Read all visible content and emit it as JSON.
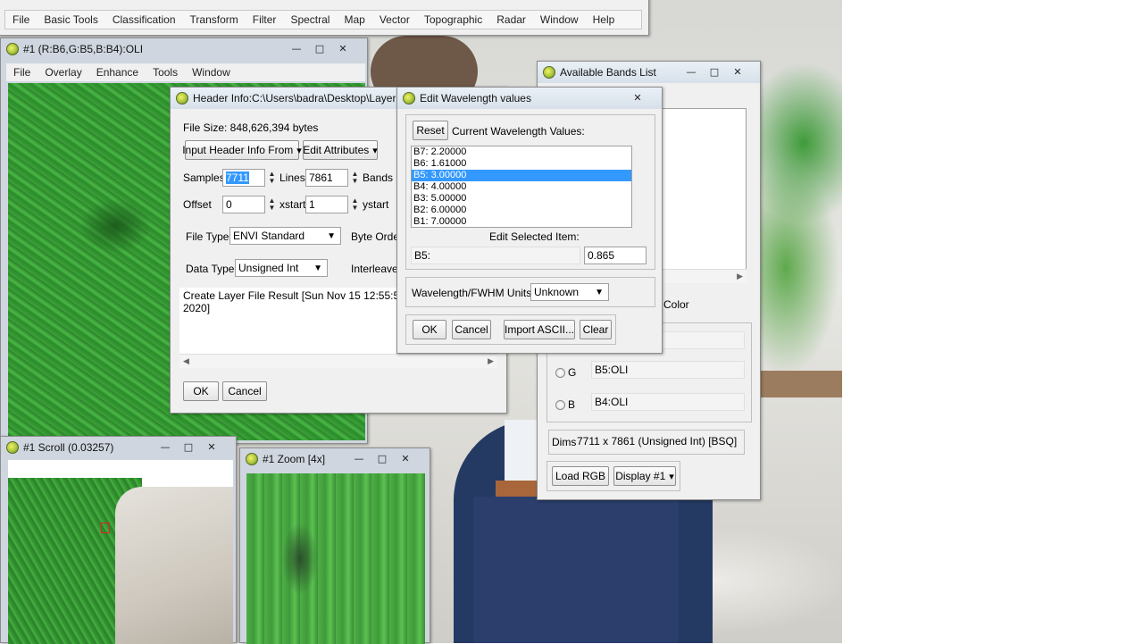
{
  "top_menu": [
    "File",
    "Basic Tools",
    "Classification",
    "Transform",
    "Filter",
    "Spectral",
    "Map",
    "Vector",
    "Topographic",
    "Radar",
    "Window",
    "Help"
  ],
  "image_window": {
    "title": "#1 (R:B6,G:B5,B:B4):OLI",
    "menu": [
      "File",
      "Overlay",
      "Enhance",
      "Tools",
      "Window"
    ]
  },
  "scroll_window": {
    "title": "#1 Scroll (0.03257)"
  },
  "zoom_window": {
    "title": "#1 Zoom [4x]"
  },
  "header_info": {
    "title": "Header Info:C:\\Users\\badra\\Desktop\\Layer",
    "file_size": "File Size: 848,626,394 bytes",
    "input_header_btn": "Input Header Info From",
    "edit_attributes_btn": "Edit Attributes",
    "samples_label": "Samples",
    "samples_value": "7711",
    "lines_label": "Lines",
    "lines_value": "7861",
    "bands_label": "Bands",
    "offset_label": "Offset",
    "offset_value": "0",
    "xstart_label": "xstart",
    "xstart_value": "1",
    "ystart_label": "ystart",
    "file_type_label": "File Type",
    "file_type_value": "ENVI Standard",
    "byte_order_label": "Byte Order",
    "data_type_label": "Data Type",
    "data_type_value": "Unsigned Int",
    "interleave_label": "Interleave",
    "log_line1": "Create Layer File Result [Sun Nov 15 12:55:54",
    "log_line2": "2020]",
    "ok": "OK",
    "cancel": "Cancel"
  },
  "wavelength": {
    "title": "Edit Wavelength values",
    "reset": "Reset",
    "current_label": "Current Wavelength Values:",
    "items": [
      "B7: 2.20000",
      "B6: 1.61000",
      "B5: 3.00000",
      "B4: 4.00000",
      "B3: 5.00000",
      "B2: 6.00000",
      "B1: 7.00000"
    ],
    "selected_index": 2,
    "edit_label": "Edit Selected Item:",
    "edit_band": "B5:",
    "edit_value": "0.865",
    "units_label": "Wavelength/FWHM Units:",
    "units_value": "Unknown",
    "ok": "OK",
    "cancel": "Cancel",
    "import": "Import ASCII...",
    "clear": "Clear"
  },
  "bands": {
    "title": "Available Bands List",
    "color_label": "Color",
    "g_label": "G",
    "g_value": "B5:OLI",
    "b_label": "B",
    "b_value": "B4:OLI",
    "dims_label": "Dims",
    "dims_value": "7711 x 7861 (Unsigned Int) [BSQ]",
    "load_rgb": "Load RGB",
    "display": "Display #1"
  },
  "colors": {
    "selection": "#3399ff",
    "vegetation": "#3a9a35",
    "window_bg": "#f0f0f0"
  }
}
